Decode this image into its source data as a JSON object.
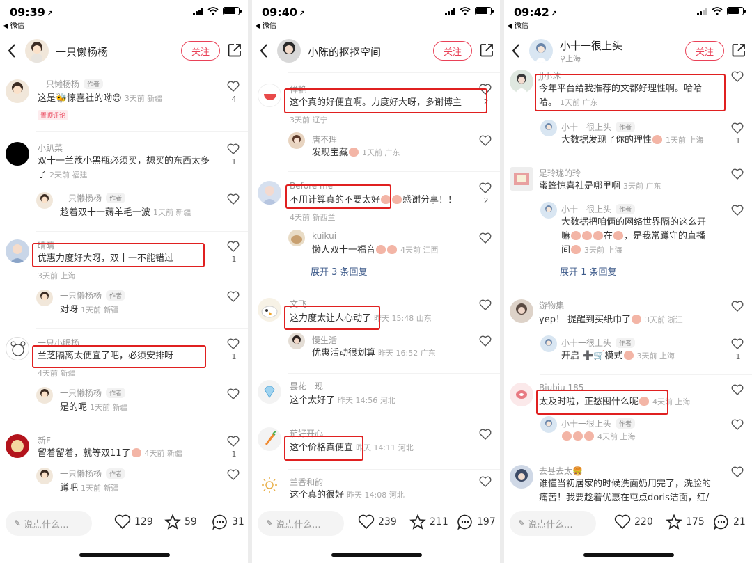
{
  "status": {
    "back_app": "◀ 微信",
    "location_arrow": "↗"
  },
  "colors": {
    "accent": "#e94157",
    "highlight": "#e02020",
    "link": "#3d5a8a"
  },
  "tags": {
    "author": "作者",
    "pinned": "置顶评论"
  },
  "phones": [
    {
      "time": "09:39",
      "nav": {
        "title": "一只懒杨杨",
        "sub": "",
        "follow": "关注"
      },
      "bottom": {
        "input": "说点什么...",
        "likes": "129",
        "stars": "59",
        "comments": "31"
      },
      "c": [
        {
          "name": "一只懒杨杨",
          "text": "这是🐝惊喜社的呦😊",
          "time": "3天前 新疆",
          "likes": "4"
        },
        {
          "name": "小趴菜",
          "text1": "双十一兰蔻小黑瓶必须买，想买的东西太多",
          "text2": "了",
          "time": "2天前 福建",
          "likes": "1",
          "reply": {
            "name": "一只懒杨杨",
            "text": "趁着双十一薅羊毛一波",
            "time": "1天前 新疆"
          }
        },
        {
          "name": "晴晴",
          "text": "优惠力度好大呀，双十一不能错过",
          "time": "3天前 上海",
          "likes": "1",
          "reply": {
            "name": "一只懒杨杨",
            "text": "对呀",
            "time": "1天前 新疆"
          }
        },
        {
          "name": "一只小眼杨",
          "text": "兰芝隔离太便宜了吧，必须安排呀",
          "time": "4天前 新疆",
          "likes": "1",
          "reply": {
            "name": "一只懒杨杨",
            "text": "是的呢",
            "time": "1天前 新疆"
          }
        },
        {
          "name": "新F",
          "text": "留着留着，就等双11了",
          "time": "4天前 新疆",
          "likes": "1",
          "reply": {
            "name": "一只懒杨杨",
            "text": "蹲吧",
            "time": "1天前 新疆"
          }
        }
      ]
    },
    {
      "time": "09:40",
      "nav": {
        "title": "小陈的抠抠空间",
        "sub": "",
        "follow": "关注"
      },
      "bottom": {
        "input": "说点什么...",
        "likes": "239",
        "stars": "211",
        "comments": "197"
      },
      "c": [
        {
          "name": "祥艳",
          "text": "这个真的好便宜啊。力度好大呀，多谢博主",
          "time": "3天前 辽宁",
          "likes": "2",
          "reply": {
            "name": "唐不理",
            "text": "发现宝藏",
            "time": "1天前 广东"
          }
        },
        {
          "name": "Before me",
          "text": "不用计算真的不要太好",
          "text_b": "感谢分享！！",
          "time": "4天前 新西兰",
          "likes": "2",
          "reply": {
            "name": "kuikui",
            "text": "懒人双十一福音",
            "time": "4天前 江西"
          },
          "expand": "展开 3 条回复"
        },
        {
          "name": "文飞",
          "text": "这力度太让人心动了",
          "time": "昨天 15:48 山东",
          "likes": "",
          "reply": {
            "name": "慢生活",
            "text": "优惠活动很划算",
            "time": "昨天 16:52 广东"
          }
        },
        {
          "name": "昙花一现",
          "text": "这个太好了",
          "time": "昨天 14:56 河北",
          "likes": ""
        },
        {
          "name": "茄好开心",
          "text": "这个价格真便宜",
          "time": "昨天 14:11 河北",
          "likes": ""
        },
        {
          "name": "兰香和韵",
          "text": "这个真的很好",
          "time": "昨天 14:08 河北",
          "likes": ""
        }
      ]
    },
    {
      "time": "09:42",
      "nav": {
        "title": "小十一很上头",
        "sub": "上海",
        "follow": "关注"
      },
      "bottom": {
        "input": "说点什么...",
        "likes": "220",
        "stars": "175",
        "comments": "21"
      },
      "c": [
        {
          "name": "JJ小沐",
          "text1": "今年平台给我推荐的文都好理性啊。哈哈",
          "text2": "哈。",
          "time": "1天前 广东",
          "likes": "",
          "reply": {
            "name": "小十一很上头",
            "text": "大数据发现了你的理性",
            "time": "1天前 上海",
            "likes": "1"
          }
        },
        {
          "name": "是玲珑的玲",
          "text": "蜜蜂惊喜社是哪里啊",
          "time": "3天前 广东",
          "likes": "",
          "reply": {
            "name": "小十一很上头",
            "text1": "大数据把咱俩的网络世界隔的这么开",
            "text2": "嘛",
            "text2b": "在",
            "text2c": "，是我常蹲守的直播",
            "text3": "间",
            "time": "3天前 上海"
          },
          "expand": "展开 1 条回复"
        },
        {
          "name": "游物集",
          "text": "yep！ 提醒到买纸巾了",
          "time": "3天前 浙江",
          "likes": "",
          "reply": {
            "name": "小十一很上头",
            "text": "开启 ➕🛒模式",
            "time": "3天前 上海",
            "likes": "1"
          }
        },
        {
          "name": "Biubiu 185",
          "text": "太及时啦，正愁囤什么呢",
          "time": "4天前 上海",
          "likes": "",
          "reply": {
            "name": "小十一很上头",
            "text": "",
            "time": "4天前 上海"
          }
        },
        {
          "name": "去甚去太🍔",
          "text1": "谁懂当初居家的时候洗面奶用完了，洗脸的",
          "text2": "痛苦！我要趁着优惠在屯点doris洁面，红/",
          "time": "",
          "likes": ""
        }
      ]
    }
  ]
}
